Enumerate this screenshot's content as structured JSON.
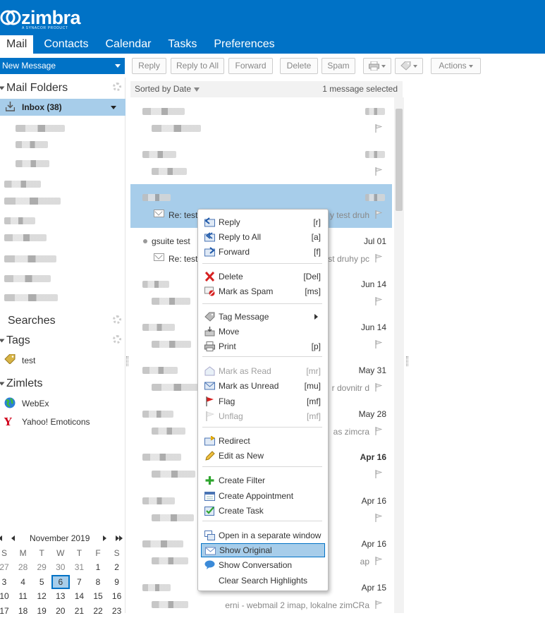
{
  "header": {
    "logo_text": "zimbra",
    "logo_sub": "A SYNACOR PRODUCT",
    "tabs": [
      "Mail",
      "Contacts",
      "Calendar",
      "Tasks",
      "Preferences"
    ]
  },
  "toolbar": {
    "new_message": "New Message",
    "reply": "Reply",
    "reply_all": "Reply to All",
    "forward": "Forward",
    "delete": "Delete",
    "spam": "Spam",
    "actions": "Actions"
  },
  "left": {
    "mail_folders": "Mail Folders",
    "inbox": "Inbox (38)",
    "searches": "Searches",
    "tags": "Tags",
    "tag_items": [
      "test"
    ],
    "zimlets": "Zimlets",
    "zimlet_items": [
      "WebEx",
      "Yahoo! Emoticons"
    ]
  },
  "calendar": {
    "month": "November 2019",
    "dow": [
      "S",
      "M",
      "T",
      "W",
      "T",
      "F",
      "S"
    ],
    "weeks": [
      [
        "27",
        "28",
        "29",
        "30",
        "31",
        "1",
        "2"
      ],
      [
        "3",
        "4",
        "5",
        "6",
        "7",
        "8",
        "9"
      ],
      [
        "10",
        "11",
        "12",
        "13",
        "14",
        "15",
        "16"
      ],
      [
        "17",
        "18",
        "19",
        "20",
        "21",
        "22",
        "23"
      ]
    ],
    "today": "6"
  },
  "list": {
    "sort_label": "Sorted by Date",
    "selection": "1 message selected",
    "messages": [
      {
        "from": "",
        "date": "",
        "subject": "",
        "fragment": ""
      },
      {
        "from": "",
        "date": "",
        "subject": "",
        "fragment": ""
      },
      {
        "from": "",
        "date": "",
        "subject": "Re: testo",
        "fragment": "y test druh"
      },
      {
        "from": "gsuite test",
        "date": "Jul 01",
        "subject": "Re: testo",
        "fragment": "st druhy pc"
      },
      {
        "from": "",
        "date": "Jun 14",
        "subject": "",
        "fragment": ""
      },
      {
        "from": "",
        "date": "Jun 14",
        "subject": "",
        "fragment": ""
      },
      {
        "from": "",
        "date": "May 31",
        "subject": "",
        "fragment": "r dovnitr d"
      },
      {
        "from": "",
        "date": "May 28",
        "subject": "",
        "fragment": "as zimcra"
      },
      {
        "from": "",
        "date": "Apr 16",
        "subject": "",
        "fragment": ""
      },
      {
        "from": "",
        "date": "Apr 16",
        "subject": "",
        "fragment": ""
      },
      {
        "from": "",
        "date": "Apr 16",
        "subject": "",
        "fragment": "ap"
      },
      {
        "from": "",
        "date": "Apr 15",
        "subject": "",
        "fragment": "erni - webmail 2 imap, lokalne zimCRa"
      }
    ]
  },
  "context_menu": {
    "items": [
      {
        "label": "Reply",
        "key": "[r]"
      },
      {
        "label": "Reply to All",
        "key": "[a]"
      },
      {
        "label": "Forward",
        "key": "[f]"
      },
      {
        "label": "Delete",
        "key": "[Del]"
      },
      {
        "label": "Mark as Spam",
        "key": "[ms]"
      },
      {
        "label": "Tag Message",
        "key": ""
      },
      {
        "label": "Move",
        "key": ""
      },
      {
        "label": "Print",
        "key": "[p]"
      },
      {
        "label": "Mark as Read",
        "key": "[mr]"
      },
      {
        "label": "Mark as Unread",
        "key": "[mu]"
      },
      {
        "label": "Flag",
        "key": "[mf]"
      },
      {
        "label": "Unflag",
        "key": "[mf]"
      },
      {
        "label": "Redirect",
        "key": ""
      },
      {
        "label": "Edit as New",
        "key": ""
      },
      {
        "label": "Create Filter",
        "key": ""
      },
      {
        "label": "Create Appointment",
        "key": ""
      },
      {
        "label": "Create Task",
        "key": ""
      },
      {
        "label": "Open in a separate window",
        "key": ""
      },
      {
        "label": "Show Original",
        "key": ""
      },
      {
        "label": "Show Conversation",
        "key": ""
      },
      {
        "label": "Clear Search Highlights",
        "key": ""
      }
    ]
  },
  "colors": {
    "brand": "#0072c6",
    "selection": "#a7cdea"
  }
}
